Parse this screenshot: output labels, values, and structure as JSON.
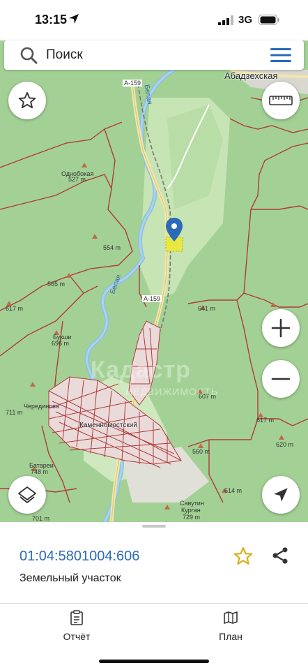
{
  "status": {
    "time": "13:15",
    "network": "3G"
  },
  "search": {
    "placeholder": "Поиск"
  },
  "map": {
    "town_top": "Абадзехская",
    "town_main": "Каменномостский",
    "road_1": "А-159",
    "road_2": "А-159",
    "river_1": "Белая",
    "river_2": "Белая",
    "peak_odnobokaya": "Однобокая",
    "peak_odnobokaya_height": "527 m",
    "h_554": "554 m",
    "h_565": "565 m",
    "h_617a": "617 m",
    "h_641": "641 m",
    "peak_bukshi": "Букши",
    "h_696": "696 m",
    "h_711": "711 m",
    "peak_cheredinova": "Черединова",
    "peak_batarei": "Батареи",
    "h_748": "748 m",
    "h_607": "607 m",
    "h_617b": "617 m",
    "h_620": "620 m",
    "h_560": "560 m",
    "h_614": "614 m",
    "peak_savutin": "Савутин",
    "peak_kurgan": "Курган",
    "h_729": "729 m",
    "h_701": "701 m",
    "watermark": "Кадастр",
    "watermark2": "НЕДВИЖИМОСТЬ"
  },
  "parcel": {
    "cadastral_number": "01:04:5801004:606",
    "type": "Земельный участок"
  },
  "tabs": [
    {
      "label": "Отчёт"
    },
    {
      "label": "План"
    }
  ],
  "colors": {
    "accent": "#2a6ab8",
    "favorite_star": "#d9b21f",
    "forest": "#9fcf8f",
    "boundary": "#b03a3a"
  }
}
